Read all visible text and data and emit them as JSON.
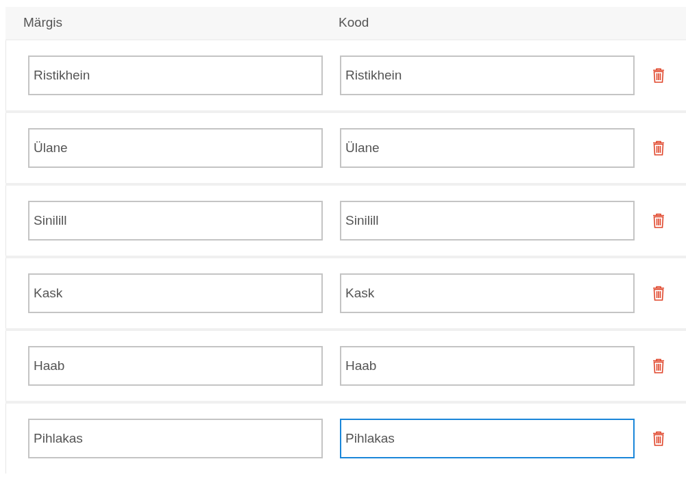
{
  "columns": [
    "Märgis",
    "Kood"
  ],
  "rows": [
    {
      "label": {
        "value": "Ristikhein",
        "focused": false
      },
      "code": {
        "value": "Ristikhein",
        "focused": false
      }
    },
    {
      "label": {
        "value": "Ülane",
        "focused": false
      },
      "code": {
        "value": "Ülane",
        "focused": false
      }
    },
    {
      "label": {
        "value": "Sinilill",
        "focused": false
      },
      "code": {
        "value": "Sinilill",
        "focused": false
      }
    },
    {
      "label": {
        "value": "Kask",
        "focused": false
      },
      "code": {
        "value": "Kask",
        "focused": false
      }
    },
    {
      "label": {
        "value": "Haab",
        "focused": false
      },
      "code": {
        "value": "Haab",
        "focused": false
      }
    },
    {
      "label": {
        "value": "Pihlakas",
        "focused": false
      },
      "code": {
        "value": "Pihlakas",
        "focused": true
      }
    }
  ]
}
